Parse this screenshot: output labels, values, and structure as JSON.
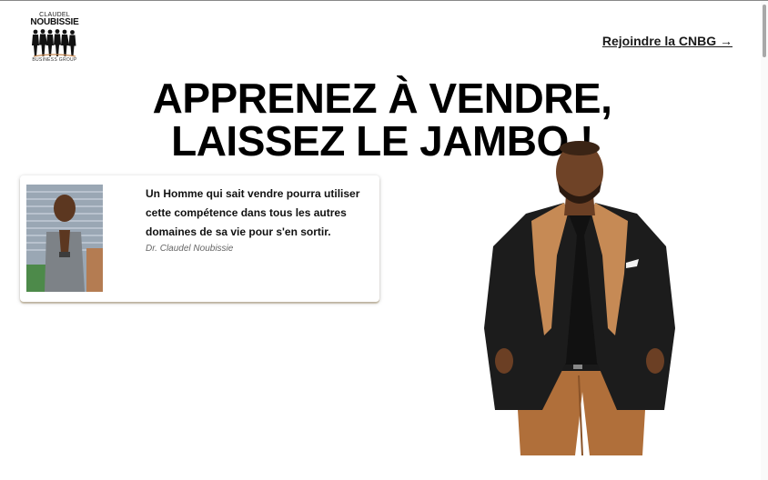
{
  "logo": {
    "top_text": "CLAUDEL",
    "name": "NOUBISSIE",
    "bottom_text": "BUSINESS GROUP",
    "icon": "people-silhouettes-icon"
  },
  "nav": {
    "join_label": "Rejoindre la CNBG →"
  },
  "hero": {
    "headline_line1": "APPRENEZ À VENDRE,",
    "headline_line2": "LAISSEZ LE JAMBO !",
    "image": "man-in-black-and-tan-blazer-photo"
  },
  "quote": {
    "text": "Un Homme qui sait vendre pourra utiliser cette compétence dans tous les autres domaines de sa vie pour s'en sortir.",
    "author": "Dr. Claudel Noubissie",
    "photo": "man-praying-hands-photo"
  },
  "colors": {
    "accent_tan": "#c68a55",
    "text": "#111111",
    "card_shadow": "#a08246"
  }
}
